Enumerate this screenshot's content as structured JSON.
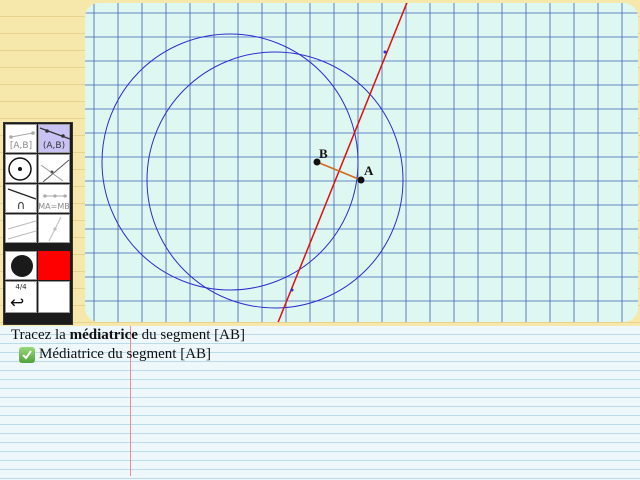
{
  "board": {
    "point_a_label": "A",
    "point_b_label": "B",
    "grid_color": "#3b62b7",
    "circle_color": "#2d2dd0",
    "bisector_color": "#e01010",
    "segment_color": "#d2691e",
    "background_color": "#dff7f1"
  },
  "toolbox": {
    "tools": {
      "segment": "[A,B]",
      "line": "(A,B)",
      "intersection": "∩",
      "equidistant": "MA=MB",
      "page": "4/4",
      "undo": "↩"
    },
    "selected_tool": "line",
    "fill_color": "#ff0000"
  },
  "instruction": {
    "prefix": "Tracez la ",
    "keyword": "médiatrice",
    "suffix": " du segment [AB]"
  },
  "task": {
    "label": "Médiatrice du segment [AB]",
    "status": "completed"
  }
}
